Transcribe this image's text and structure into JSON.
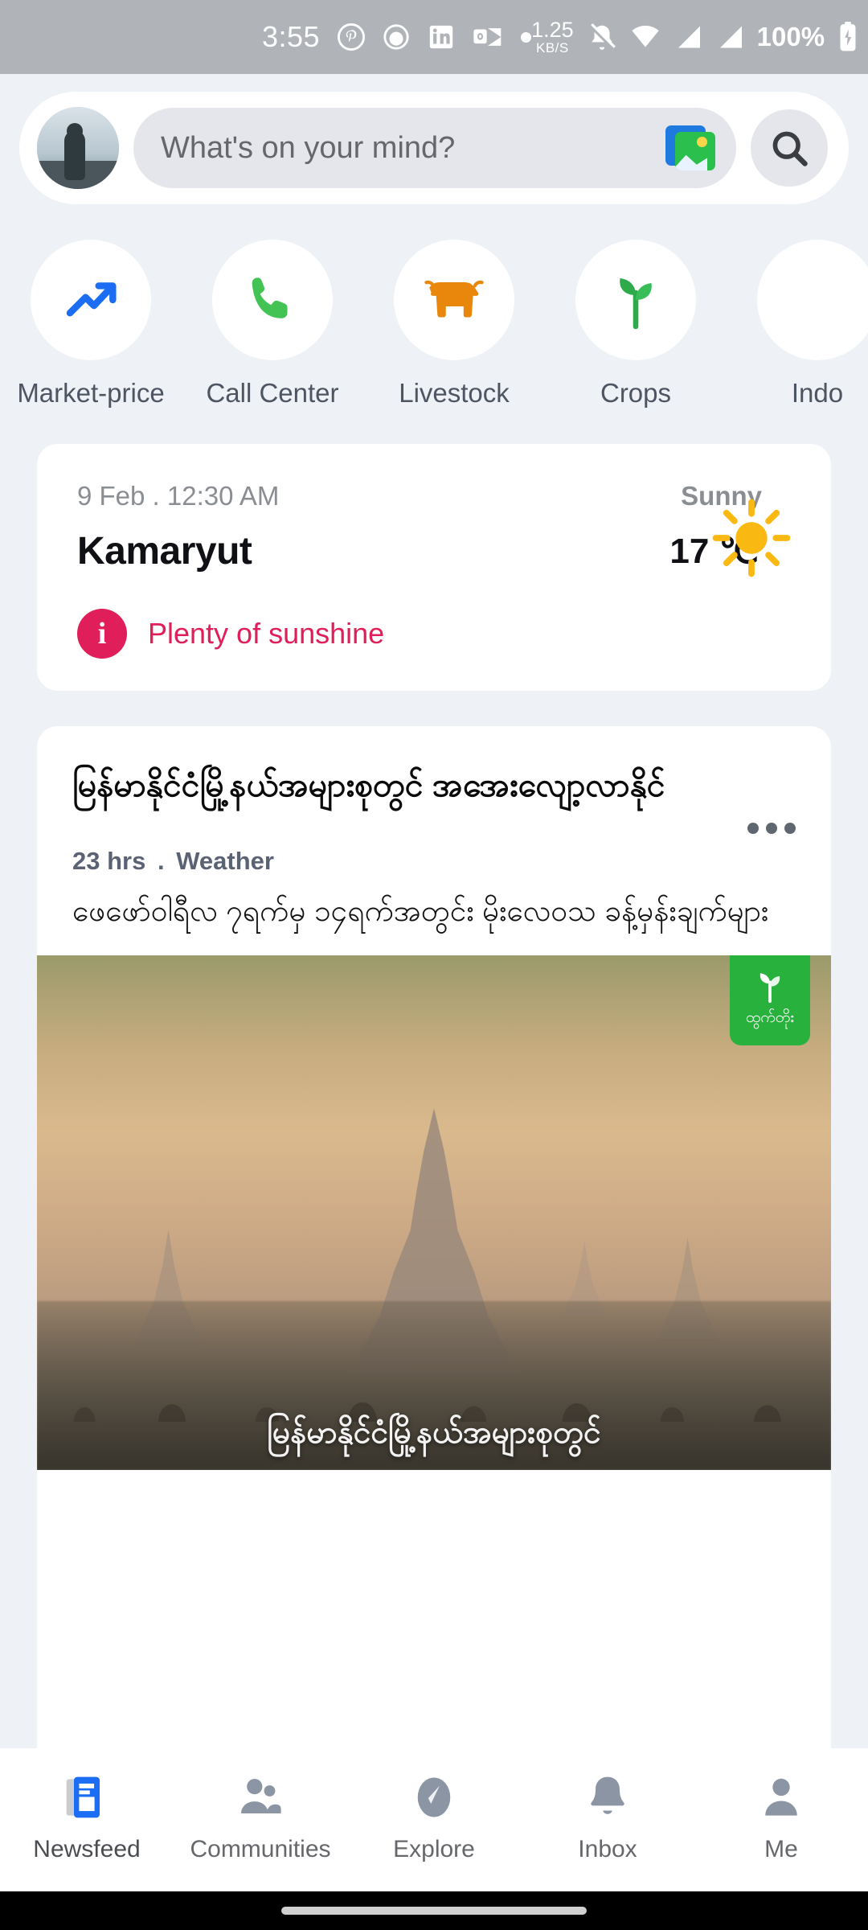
{
  "status_bar": {
    "time": "3:55",
    "icons": [
      "pinterest-icon",
      "circle-record-icon",
      "linkedin-icon",
      "outlook-icon",
      "dot-icon"
    ],
    "network_speed_value": "1.25",
    "network_speed_unit": "KB/S",
    "right_icons": [
      "mute-icon",
      "wifi-icon",
      "signal-1-icon",
      "signal-2-icon"
    ],
    "battery": "100%"
  },
  "topbar": {
    "avatar_name": "user-avatar",
    "composer_placeholder": "What's on your mind?",
    "photo_button": "photo-icon",
    "search_button": "search-icon"
  },
  "shortcuts": [
    {
      "label": "Market-price",
      "icon": "trending-up-icon"
    },
    {
      "label": "Call Center",
      "icon": "phone-icon"
    },
    {
      "label": "Livestock",
      "icon": "cow-icon"
    },
    {
      "label": "Crops",
      "icon": "sprout-icon"
    },
    {
      "label": "Indo",
      "icon": "partial-icon"
    }
  ],
  "weather": {
    "date": "9 Feb . 12:30 AM",
    "condition": "Sunny",
    "city": "Kamaryut",
    "temperature": "17 ℃",
    "description": "Plenty of sunshine",
    "icon": "sun-icon",
    "accent_color": "#e01e5a",
    "sun_color": "#fbbf24"
  },
  "post": {
    "title": "မြန်မာနိုင်ငံမြို့နယ်အများစုတွင် အအေးလျော့လာနိုင်",
    "time": "23 hrs",
    "separator": ".",
    "category": "Weather",
    "body": "ဖေဖော်ဝါရီလ ၇ရက်မှ ၁၄ရက်အတွင်း မိုးလေဝသ ခန့်မှန်းချက်များ",
    "more_button": "more-options-icon",
    "image_caption": "မြန်မာနိုင်ငံမြို့နယ်အများစုတွင်",
    "image_badge_label": "ထွက်တိုး",
    "image_badge_color": "#29b13e"
  },
  "bottom_nav": [
    {
      "label": "Newsfeed",
      "icon": "newsfeed-icon",
      "active": true
    },
    {
      "label": "Communities",
      "icon": "people-icon",
      "active": false
    },
    {
      "label": "Explore",
      "icon": "compass-icon",
      "active": false
    },
    {
      "label": "Inbox",
      "icon": "bell-icon",
      "active": false
    },
    {
      "label": "Me",
      "icon": "person-icon",
      "active": false
    }
  ]
}
